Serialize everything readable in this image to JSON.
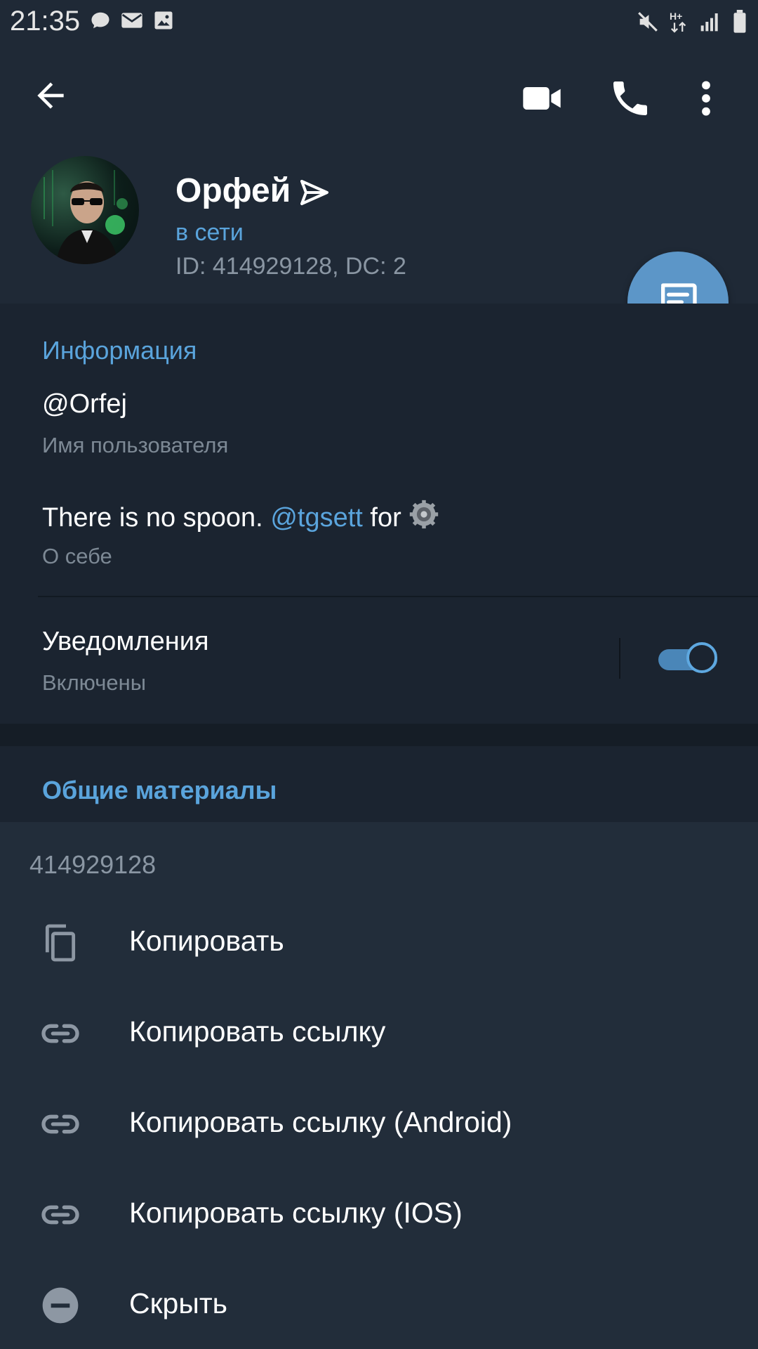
{
  "status_bar": {
    "time": "21:35",
    "left_icons": [
      "chat-bubble-icon",
      "mail-icon",
      "image-icon"
    ],
    "right_icons": [
      "mute-icon",
      "hplus-data-icon",
      "signal-icon",
      "battery-icon"
    ]
  },
  "header": {
    "actions": [
      "back-arrow-icon",
      "video-camera-icon",
      "phone-icon",
      "more-vertical-icon"
    ]
  },
  "profile": {
    "name": "Орфей",
    "status": "в сети",
    "id_line": "ID: 414929128, DC: 2"
  },
  "info": {
    "section_title": "Информация",
    "username": "@Orfej",
    "username_label": "Имя пользователя",
    "bio_prefix": "There is no spoon. ",
    "bio_link": "@tgsett",
    "bio_suffix": " for ",
    "bio_label": "О себе",
    "notifications_title": "Уведомления",
    "notifications_status": "Включены",
    "notifications_enabled": true
  },
  "shared": {
    "section_title": "Общие материалы"
  },
  "context_sheet": {
    "title": "414929128",
    "items": [
      {
        "label": "Копировать",
        "icon": "copy-icon"
      },
      {
        "label": "Копировать ссылку",
        "icon": "link-icon"
      },
      {
        "label": "Копировать ссылку (Android)",
        "icon": "link-icon"
      },
      {
        "label": "Копировать ссылку (IOS)",
        "icon": "link-icon"
      },
      {
        "label": "Скрыть",
        "icon": "minus-circle-icon"
      }
    ]
  },
  "colors": {
    "accent": "#5aa4dc",
    "background": "#1d2733",
    "fab": "#5c96c8",
    "sheet": "#222d3a"
  }
}
